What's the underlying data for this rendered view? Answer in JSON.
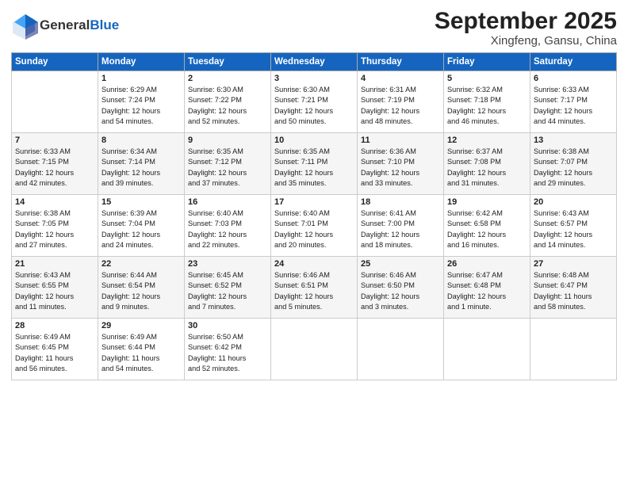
{
  "header": {
    "logo_line1": "General",
    "logo_line2": "Blue",
    "month": "September 2025",
    "location": "Xingfeng, Gansu, China"
  },
  "days_of_week": [
    "Sunday",
    "Monday",
    "Tuesday",
    "Wednesday",
    "Thursday",
    "Friday",
    "Saturday"
  ],
  "weeks": [
    [
      {
        "day": "",
        "info": ""
      },
      {
        "day": "1",
        "info": "Sunrise: 6:29 AM\nSunset: 7:24 PM\nDaylight: 12 hours\nand 54 minutes."
      },
      {
        "day": "2",
        "info": "Sunrise: 6:30 AM\nSunset: 7:22 PM\nDaylight: 12 hours\nand 52 minutes."
      },
      {
        "day": "3",
        "info": "Sunrise: 6:30 AM\nSunset: 7:21 PM\nDaylight: 12 hours\nand 50 minutes."
      },
      {
        "day": "4",
        "info": "Sunrise: 6:31 AM\nSunset: 7:19 PM\nDaylight: 12 hours\nand 48 minutes."
      },
      {
        "day": "5",
        "info": "Sunrise: 6:32 AM\nSunset: 7:18 PM\nDaylight: 12 hours\nand 46 minutes."
      },
      {
        "day": "6",
        "info": "Sunrise: 6:33 AM\nSunset: 7:17 PM\nDaylight: 12 hours\nand 44 minutes."
      }
    ],
    [
      {
        "day": "7",
        "info": "Sunrise: 6:33 AM\nSunset: 7:15 PM\nDaylight: 12 hours\nand 42 minutes."
      },
      {
        "day": "8",
        "info": "Sunrise: 6:34 AM\nSunset: 7:14 PM\nDaylight: 12 hours\nand 39 minutes."
      },
      {
        "day": "9",
        "info": "Sunrise: 6:35 AM\nSunset: 7:12 PM\nDaylight: 12 hours\nand 37 minutes."
      },
      {
        "day": "10",
        "info": "Sunrise: 6:35 AM\nSunset: 7:11 PM\nDaylight: 12 hours\nand 35 minutes."
      },
      {
        "day": "11",
        "info": "Sunrise: 6:36 AM\nSunset: 7:10 PM\nDaylight: 12 hours\nand 33 minutes."
      },
      {
        "day": "12",
        "info": "Sunrise: 6:37 AM\nSunset: 7:08 PM\nDaylight: 12 hours\nand 31 minutes."
      },
      {
        "day": "13",
        "info": "Sunrise: 6:38 AM\nSunset: 7:07 PM\nDaylight: 12 hours\nand 29 minutes."
      }
    ],
    [
      {
        "day": "14",
        "info": "Sunrise: 6:38 AM\nSunset: 7:05 PM\nDaylight: 12 hours\nand 27 minutes."
      },
      {
        "day": "15",
        "info": "Sunrise: 6:39 AM\nSunset: 7:04 PM\nDaylight: 12 hours\nand 24 minutes."
      },
      {
        "day": "16",
        "info": "Sunrise: 6:40 AM\nSunset: 7:03 PM\nDaylight: 12 hours\nand 22 minutes."
      },
      {
        "day": "17",
        "info": "Sunrise: 6:40 AM\nSunset: 7:01 PM\nDaylight: 12 hours\nand 20 minutes."
      },
      {
        "day": "18",
        "info": "Sunrise: 6:41 AM\nSunset: 7:00 PM\nDaylight: 12 hours\nand 18 minutes."
      },
      {
        "day": "19",
        "info": "Sunrise: 6:42 AM\nSunset: 6:58 PM\nDaylight: 12 hours\nand 16 minutes."
      },
      {
        "day": "20",
        "info": "Sunrise: 6:43 AM\nSunset: 6:57 PM\nDaylight: 12 hours\nand 14 minutes."
      }
    ],
    [
      {
        "day": "21",
        "info": "Sunrise: 6:43 AM\nSunset: 6:55 PM\nDaylight: 12 hours\nand 11 minutes."
      },
      {
        "day": "22",
        "info": "Sunrise: 6:44 AM\nSunset: 6:54 PM\nDaylight: 12 hours\nand 9 minutes."
      },
      {
        "day": "23",
        "info": "Sunrise: 6:45 AM\nSunset: 6:52 PM\nDaylight: 12 hours\nand 7 minutes."
      },
      {
        "day": "24",
        "info": "Sunrise: 6:46 AM\nSunset: 6:51 PM\nDaylight: 12 hours\nand 5 minutes."
      },
      {
        "day": "25",
        "info": "Sunrise: 6:46 AM\nSunset: 6:50 PM\nDaylight: 12 hours\nand 3 minutes."
      },
      {
        "day": "26",
        "info": "Sunrise: 6:47 AM\nSunset: 6:48 PM\nDaylight: 12 hours\nand 1 minute."
      },
      {
        "day": "27",
        "info": "Sunrise: 6:48 AM\nSunset: 6:47 PM\nDaylight: 11 hours\nand 58 minutes."
      }
    ],
    [
      {
        "day": "28",
        "info": "Sunrise: 6:49 AM\nSunset: 6:45 PM\nDaylight: 11 hours\nand 56 minutes."
      },
      {
        "day": "29",
        "info": "Sunrise: 6:49 AM\nSunset: 6:44 PM\nDaylight: 11 hours\nand 54 minutes."
      },
      {
        "day": "30",
        "info": "Sunrise: 6:50 AM\nSunset: 6:42 PM\nDaylight: 11 hours\nand 52 minutes."
      },
      {
        "day": "",
        "info": ""
      },
      {
        "day": "",
        "info": ""
      },
      {
        "day": "",
        "info": ""
      },
      {
        "day": "",
        "info": ""
      }
    ]
  ]
}
